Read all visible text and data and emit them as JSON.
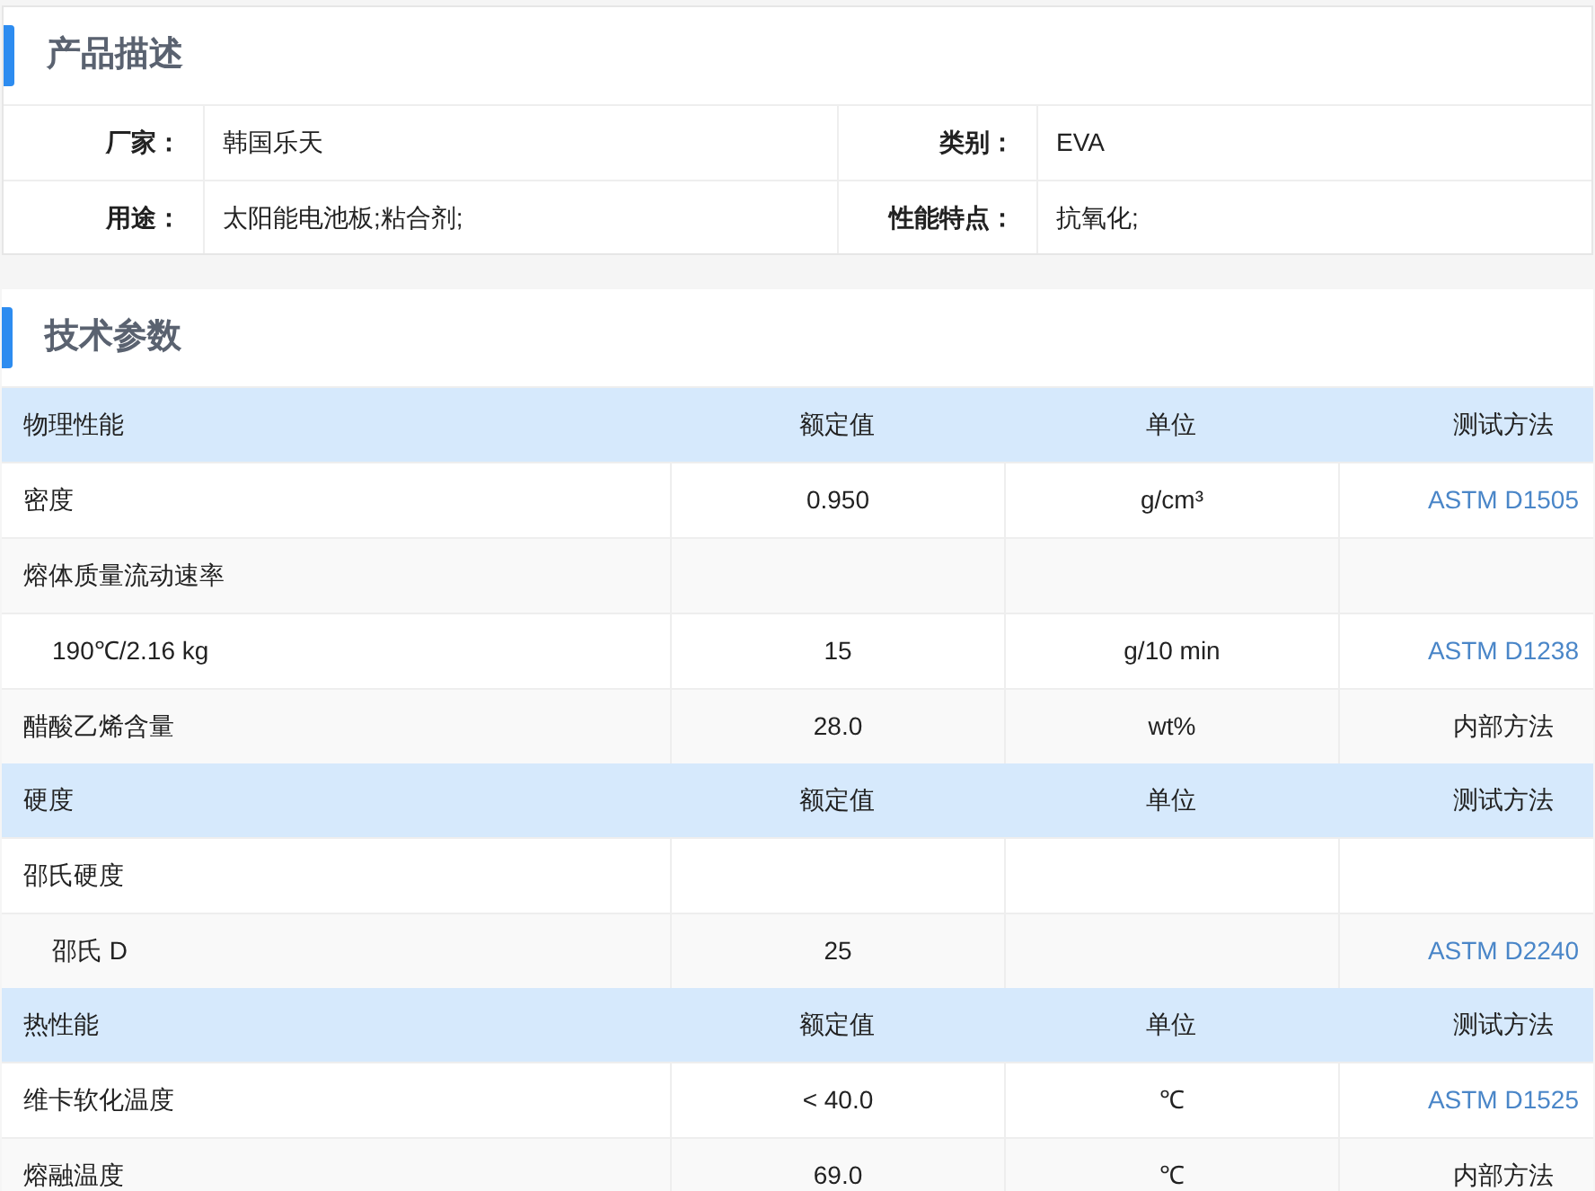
{
  "description": {
    "title": "产品描述",
    "fields": [
      {
        "label": "厂家：",
        "value": "韩国乐天"
      },
      {
        "label": "类别：",
        "value": "EVA"
      },
      {
        "label": "用途：",
        "value": "太阳能电池板;粘合剂;"
      },
      {
        "label": "性能特点：",
        "value": "抗氧化;"
      }
    ]
  },
  "technical": {
    "title": "技术参数",
    "groups": [
      {
        "columns": [
          "物理性能",
          "额定值",
          "单位",
          "测试方法"
        ],
        "rows": [
          {
            "property": "密度",
            "value": "0.950",
            "unit": "g/cm³",
            "method": "ASTM D1505",
            "method_link": true
          },
          {
            "property": "熔体质量流动速率",
            "children": [
              {
                "property": "190℃/2.16 kg",
                "value": "15",
                "unit": "g/10 min",
                "method": "ASTM D1238",
                "method_link": true
              }
            ]
          },
          {
            "property": "醋酸乙烯含量",
            "value": "28.0",
            "unit": "wt%",
            "method": "内部方法",
            "method_link": false
          }
        ]
      },
      {
        "columns": [
          "硬度",
          "额定值",
          "单位",
          "测试方法"
        ],
        "rows": [
          {
            "property": "邵氏硬度",
            "children": [
              {
                "property": "邵氏 D",
                "value": "25",
                "method": "ASTM D2240",
                "method_link": true
              }
            ]
          }
        ]
      },
      {
        "columns": [
          "热性能",
          "额定值",
          "单位",
          "测试方法"
        ],
        "rows": [
          {
            "property": "维卡软化温度",
            "value": "< 40.0",
            "unit": "℃",
            "method": "ASTM D1525",
            "method_link": true
          },
          {
            "property": "熔融温度",
            "value": "69.0",
            "unit": "℃",
            "method": "内部方法",
            "method_link": false
          }
        ]
      }
    ]
  }
}
